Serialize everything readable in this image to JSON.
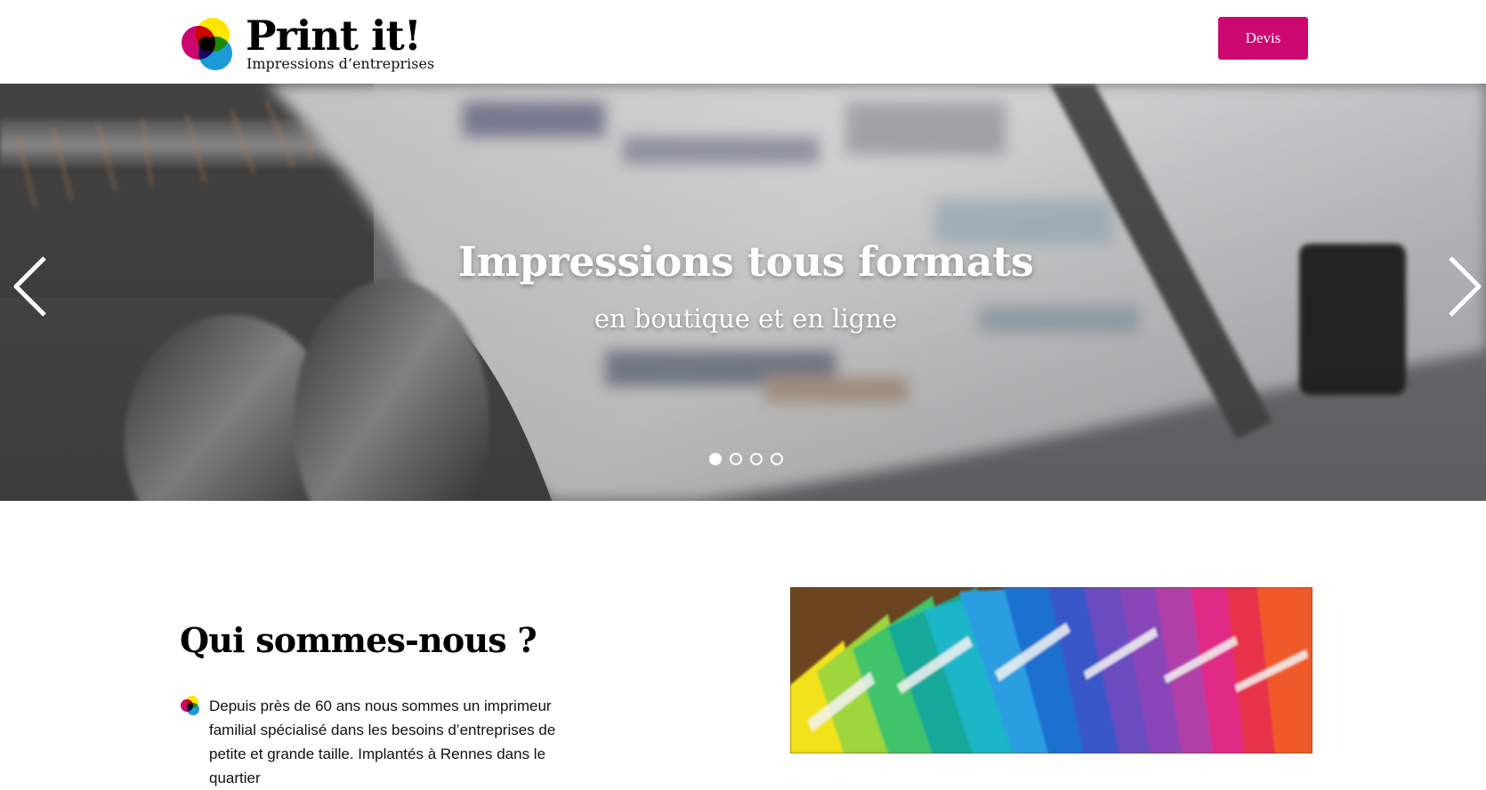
{
  "header": {
    "logo_title": "Print it!",
    "logo_tagline": "Impressions d’entreprises",
    "logo_icon": "cmyk-circles-icon",
    "quote_button_label": "Devis"
  },
  "hero": {
    "title": "Impressions tous formats",
    "subtitle": "en boutique et en ligne",
    "prev_icon": "chevron-left-icon",
    "next_icon": "chevron-right-icon",
    "slide_count": 4,
    "active_slide": 1
  },
  "about": {
    "title": "Qui sommes-nous ?",
    "bullet_icon": "cmyk-circles-icon",
    "paragraph": "Depuis près de 60 ans nous sommes un imprimeur familial spécialisé dans les besoins d’entreprises de petite et grande taille. Implantés à Rennes dans le quartier"
  },
  "colors": {
    "accent": "#cc0770",
    "cyan": "#1a9ad6",
    "magenta": "#cc0770",
    "yellow": "#ffe500",
    "black": "#000000"
  }
}
